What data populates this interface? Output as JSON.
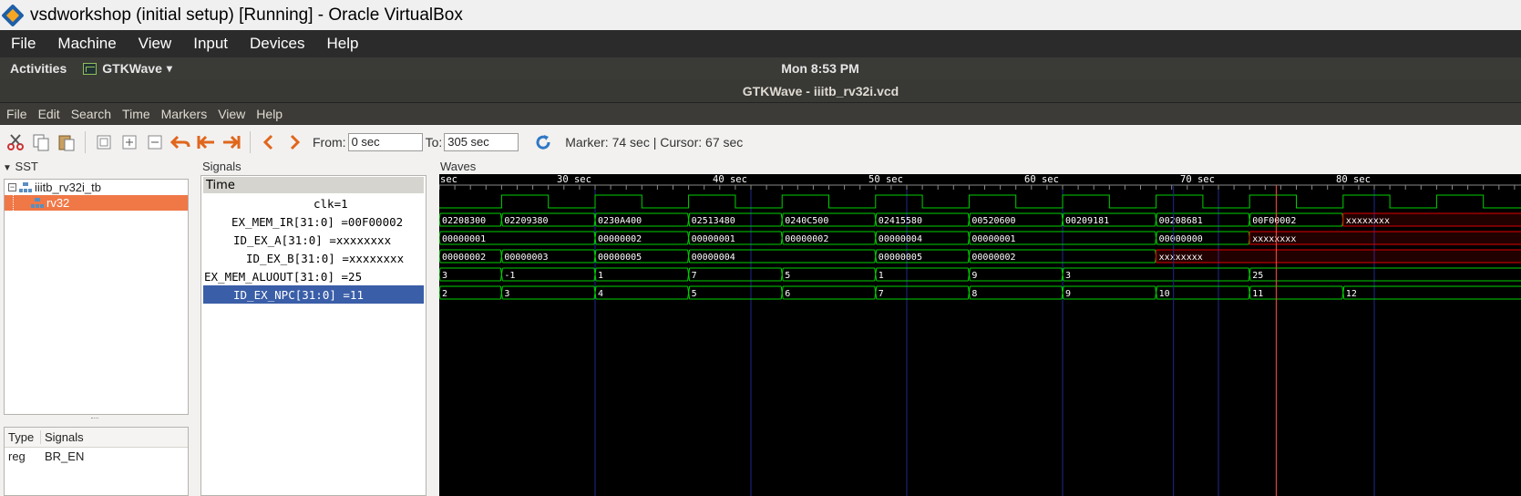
{
  "host_window": {
    "title": "vsdworkshop (initial setup) [Running] - Oracle VirtualBox"
  },
  "vbox_menu": [
    "File",
    "Machine",
    "View",
    "Input",
    "Devices",
    "Help"
  ],
  "ubuntu_panel": {
    "activities": "Activities",
    "app_name": "GTKWave",
    "app_arrow": "▾",
    "clock": "Mon  8:53 PM"
  },
  "gtk_window": {
    "title": "GTKWave - iiitb_rv32i.vcd"
  },
  "gtk_menu": [
    "File",
    "Edit",
    "Search",
    "Time",
    "Markers",
    "View",
    "Help"
  ],
  "toolbar": {
    "from_label": "From:",
    "from_value": "0 sec",
    "to_label": "To:",
    "to_value": "305 sec",
    "status": "Marker: 74 sec  |  Cursor: 67 sec"
  },
  "sst": {
    "header": "SST",
    "tree": [
      {
        "label": "iiitb_rv32i_tb",
        "selected": false
      },
      {
        "label": "rv32",
        "selected": true
      }
    ],
    "table_headers": [
      "Type",
      "Signals"
    ],
    "table_rows": [
      {
        "type": "reg",
        "signal": "BR_EN"
      }
    ]
  },
  "signals": {
    "header": "Signals",
    "time_label": "Time",
    "rows": [
      {
        "text": "clk=1",
        "indent": 17,
        "selected": false
      },
      {
        "text": "EX_MEM_IR[31:0] =00F00002",
        "indent": 4,
        "selected": false
      },
      {
        "text": "ID_EX_A[31:0] =xxxxxxxx",
        "indent": 5,
        "selected": false
      },
      {
        "text": "ID_EX_B[31:0] =xxxxxxxx",
        "indent": 6,
        "selected": false
      },
      {
        "text": "EX_MEM_ALUOUT[31:0] =25",
        "indent": 0,
        "selected": false
      },
      {
        "text": "ID_EX_NPC[31:0] =11",
        "indent": 4,
        "selected": true
      }
    ]
  },
  "waves": {
    "header": "Waves",
    "time_labels": [
      {
        "t": 20,
        "label": "sec"
      },
      {
        "t": 30,
        "label": "30 sec"
      },
      {
        "t": 40,
        "label": "40 sec"
      },
      {
        "t": 50,
        "label": "50 sec"
      },
      {
        "t": 60,
        "label": "60 sec"
      },
      {
        "t": 70,
        "label": "70 sec"
      },
      {
        "t": 80,
        "label": "80 sec"
      }
    ],
    "time_start": 20,
    "time_per_100px": 5.85,
    "marker_t": 74,
    "cursor_t": 67,
    "clock_period": 6,
    "clock_first_rise": 24,
    "colors": {
      "trace": "#00d000",
      "undefined": "#e00000",
      "text": "#ffffff",
      "grid": "#1b2a8c",
      "marker": "#ff4a4a"
    },
    "buses": [
      {
        "name": "EX_MEM_IR",
        "segments": [
          {
            "t": 20,
            "v": "02208300"
          },
          {
            "t": 24,
            "v": "02209380"
          },
          {
            "t": 30,
            "v": "0230A400"
          },
          {
            "t": 36,
            "v": "02513480"
          },
          {
            "t": 42,
            "v": "0240C500"
          },
          {
            "t": 48,
            "v": "02415580"
          },
          {
            "t": 54,
            "v": "00520600"
          },
          {
            "t": 60,
            "v": "00209181"
          },
          {
            "t": 66,
            "v": "00208681"
          },
          {
            "t": 72,
            "v": "00F00002"
          },
          {
            "t": 78,
            "v": "xxxxxxxx",
            "x": true
          }
        ]
      },
      {
        "name": "ID_EX_A",
        "segments": [
          {
            "t": 20,
            "v": "00000001"
          },
          {
            "t": 30,
            "v": "00000002"
          },
          {
            "t": 36,
            "v": "00000001"
          },
          {
            "t": 42,
            "v": "00000002"
          },
          {
            "t": 48,
            "v": "00000004"
          },
          {
            "t": 54,
            "v": "00000001"
          },
          {
            "t": 66,
            "v": "00000000"
          },
          {
            "t": 72,
            "v": "xxxxxxxx",
            "x": true
          }
        ]
      },
      {
        "name": "ID_EX_B",
        "segments": [
          {
            "t": 20,
            "v": "00000002"
          },
          {
            "t": 24,
            "v": "00000003"
          },
          {
            "t": 30,
            "v": "00000005"
          },
          {
            "t": 36,
            "v": "00000004"
          },
          {
            "t": 48,
            "v": "00000005"
          },
          {
            "t": 54,
            "v": "00000002"
          },
          {
            "t": 66,
            "v": "xxxxxxxx",
            "x": true
          }
        ]
      },
      {
        "name": "EX_MEM_ALUOUT",
        "segments": [
          {
            "t": 20,
            "v": "3"
          },
          {
            "t": 24,
            "v": "-1"
          },
          {
            "t": 30,
            "v": "1"
          },
          {
            "t": 36,
            "v": "7"
          },
          {
            "t": 42,
            "v": "5"
          },
          {
            "t": 48,
            "v": "1"
          },
          {
            "t": 54,
            "v": "9"
          },
          {
            "t": 60,
            "v": "3"
          },
          {
            "t": 72,
            "v": "25"
          }
        ]
      },
      {
        "name": "ID_EX_NPC",
        "segments": [
          {
            "t": 20,
            "v": "2"
          },
          {
            "t": 24,
            "v": "3"
          },
          {
            "t": 30,
            "v": "4"
          },
          {
            "t": 36,
            "v": "5"
          },
          {
            "t": 42,
            "v": "6"
          },
          {
            "t": 48,
            "v": "7"
          },
          {
            "t": 54,
            "v": "8"
          },
          {
            "t": 60,
            "v": "9"
          },
          {
            "t": 66,
            "v": "10"
          },
          {
            "t": 72,
            "v": "11"
          },
          {
            "t": 78,
            "v": "12"
          }
        ]
      }
    ]
  }
}
